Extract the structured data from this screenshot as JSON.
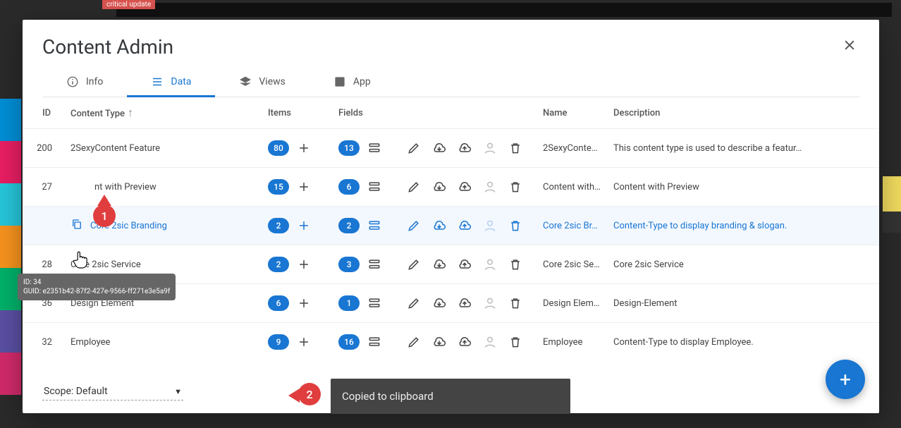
{
  "bg": {
    "critical_label": "critical update"
  },
  "modal": {
    "title": "Content Admin",
    "tabs": [
      {
        "label": "Info"
      },
      {
        "label": "Data"
      },
      {
        "label": "Views"
      },
      {
        "label": "App"
      }
    ]
  },
  "columns": {
    "id": "ID",
    "type": "Content Type",
    "items": "Items",
    "fields": "Fields",
    "name": "Name",
    "desc": "Description"
  },
  "rows": [
    {
      "id": "200",
      "type": "2SexyContent Feature",
      "items": "80",
      "fields": "13",
      "name": "2SexyConte…",
      "desc": "This content type is used to describe a featur…"
    },
    {
      "id": "27",
      "type": "Content with Preview",
      "items": "15",
      "fields": "6",
      "name": "Content with…",
      "desc": "Content with Preview"
    },
    {
      "id": "",
      "type": "Core 2sic Branding",
      "items": "2",
      "fields": "2",
      "name": "Core 2sic Br…",
      "desc": "Content-Type to display branding & slogan."
    },
    {
      "id": "28",
      "type": "Core 2sic Service",
      "items": "2",
      "fields": "3",
      "name": "Core 2sic Se…",
      "desc": "Core 2sic Service"
    },
    {
      "id": "36",
      "type": "Design Element",
      "items": "6",
      "fields": "1",
      "name": "Design Elem…",
      "desc": "Design-Element"
    },
    {
      "id": "32",
      "type": "Employee",
      "items": "9",
      "fields": "16",
      "name": "Employee",
      "desc": "Content-Type to display Employee."
    }
  ],
  "tooltip": {
    "line1": "ID: 34",
    "line2": "GUID: e2351b42-87f2-427e-9566-ff271e3e5a9f"
  },
  "scope": {
    "label": "Scope: Default"
  },
  "toast": {
    "text": "Copied to clipboard"
  },
  "callouts": {
    "one": "1",
    "two": "2"
  }
}
